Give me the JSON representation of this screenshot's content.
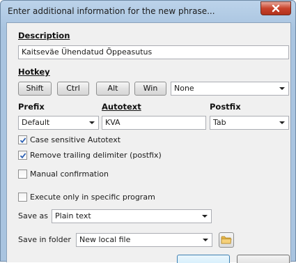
{
  "window": {
    "title": "Enter additional information for the new phrase..."
  },
  "description": {
    "label": "Description",
    "value": "Kaitseväe Ühendatud Õppeasutus"
  },
  "hotkey": {
    "label": "Hotkey",
    "shift": "Shift",
    "ctrl": "Ctrl",
    "alt": "Alt",
    "win": "Win",
    "key_value": "None"
  },
  "prefix": {
    "label": "Prefix",
    "value": "Default"
  },
  "autotext": {
    "label": "Autotext",
    "value": "KVA"
  },
  "postfix": {
    "label": "Postfix",
    "value": "Tab"
  },
  "options": {
    "case_sensitive": {
      "label": "Case sensitive Autotext",
      "checked": true
    },
    "remove_trailing": {
      "label": "Remove trailing delimiter (postfix)",
      "checked": true
    },
    "manual_confirmation": {
      "label": "Manual confirmation",
      "checked": false
    },
    "execute_specific": {
      "label": "Execute only in specific program",
      "checked": false
    }
  },
  "save_as": {
    "label": "Save as",
    "value": "Plain text"
  },
  "save_in_folder": {
    "label": "Save in folder",
    "value": "New local file"
  },
  "colors": {
    "accent": "#3399ff",
    "close": "#c8432c",
    "check": "#2b5fb3"
  },
  "icons": {
    "close": "close-icon",
    "folder": "folder-icon",
    "check": "checkmark-icon"
  }
}
